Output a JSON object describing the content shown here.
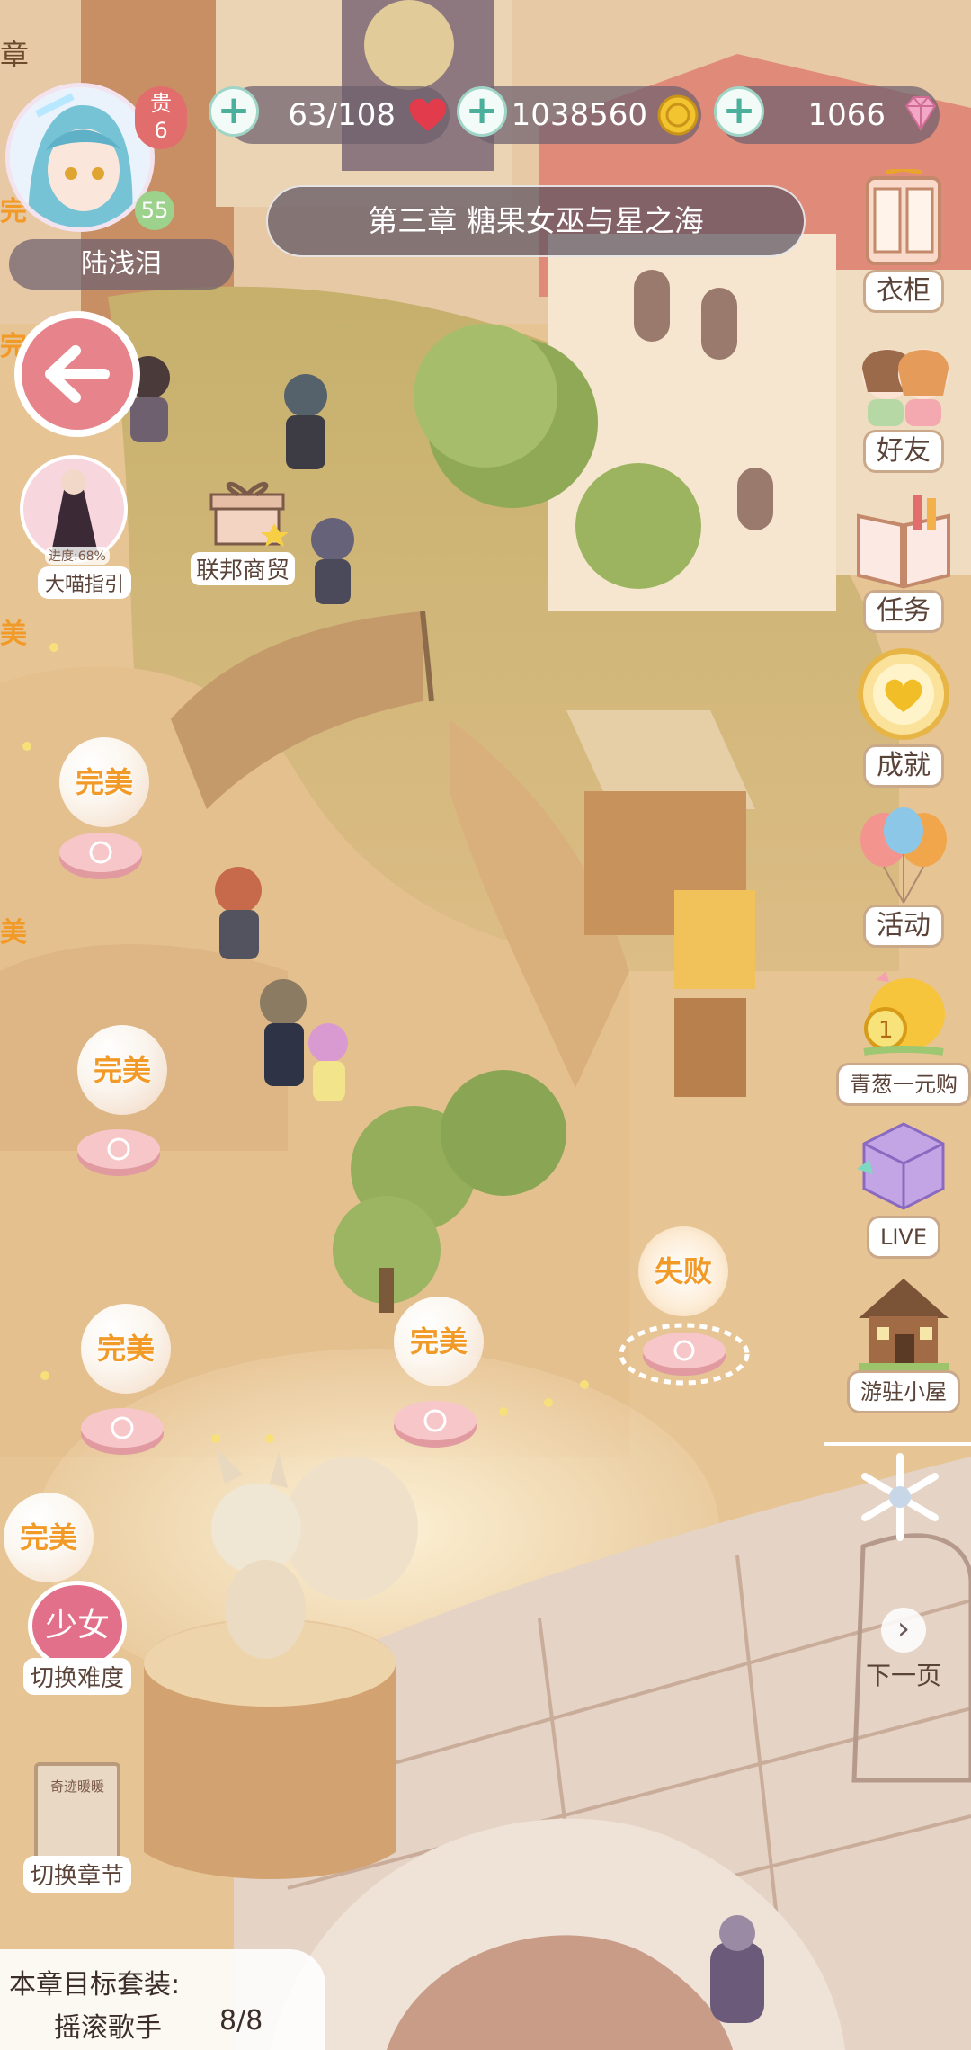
{
  "resources": {
    "stamina": "63/108",
    "gold": "1038560",
    "diamonds": "1066"
  },
  "player": {
    "name": "陆浅泪",
    "level": "55",
    "vip_label": "贵",
    "vip_level": "6"
  },
  "chapter_title": "第三章 糖果女巫与星之海",
  "left_edge_fragments": [
    "章",
    "完",
    "完",
    "美",
    "美"
  ],
  "left_menu": {
    "guide_label": "大喵指引",
    "guide_progress": "进度:68%",
    "difficulty_badge": "少女",
    "difficulty_label": "切换难度",
    "chapter_book_text": "奇迹暖暖",
    "chapter_switch_label": "切换章节"
  },
  "federation_label": "联邦商贸",
  "right_menu": [
    {
      "icon": "wardrobe-icon",
      "label": "衣柜"
    },
    {
      "icon": "friends-icon",
      "label": "好友"
    },
    {
      "icon": "tasks-book-icon",
      "label": "任务"
    },
    {
      "icon": "achievement-badge-icon",
      "label": "成就"
    },
    {
      "icon": "balloons-icon",
      "label": "活动"
    },
    {
      "icon": "chick-coin-icon",
      "label": "青葱一元购"
    },
    {
      "icon": "cube-icon",
      "label": "LIVE"
    },
    {
      "icon": "house-icon",
      "label": "游驻小屋"
    }
  ],
  "next_page_label": "下一页",
  "levels": [
    {
      "status": "完美"
    },
    {
      "status": "完美"
    },
    {
      "status": "完美"
    },
    {
      "status": "完美"
    },
    {
      "status": "失败"
    },
    {
      "status": "完美"
    }
  ],
  "target": {
    "title": "本章目标套装:",
    "suit_name": "摇滚歌手",
    "progress": "8/8"
  },
  "colors": {
    "accent_pink": "#e7848b",
    "perfect_text": "#f29a28",
    "pill_bg": "#6e606e"
  }
}
